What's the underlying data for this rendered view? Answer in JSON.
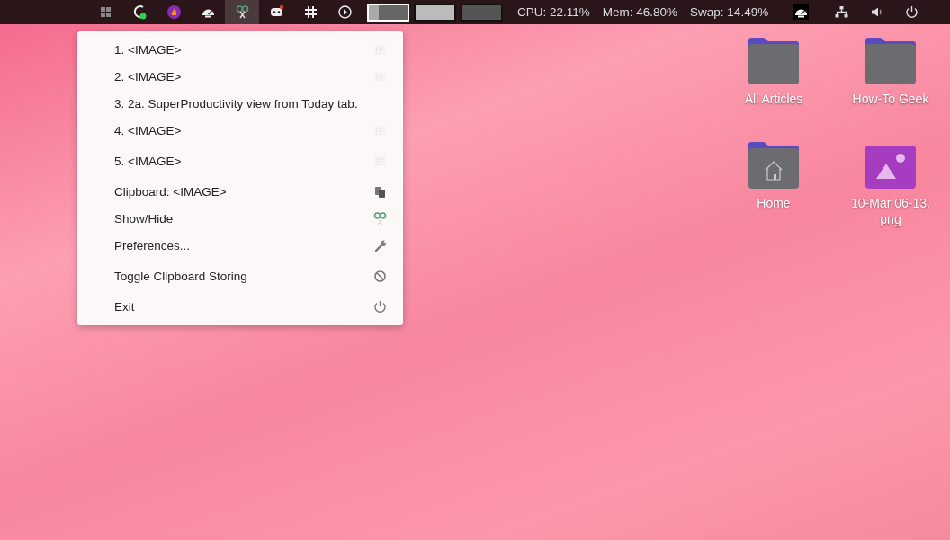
{
  "panel": {
    "apps": [
      {
        "active": false
      },
      {
        "active": false
      },
      {
        "active": false
      },
      {
        "active": false
      },
      {
        "active": true
      },
      {
        "active": false
      },
      {
        "active": false
      },
      {
        "active": false
      }
    ],
    "workspaces": [
      {
        "selected": true
      },
      {
        "selected": false
      },
      {
        "selected": false
      }
    ],
    "stats": [
      "CPU: 22.11%",
      "Mem: 46.80%",
      "Swap: 14.49%"
    ]
  },
  "menu": {
    "items": [
      {
        "label": "1. <IMAGE>"
      },
      {
        "label": "2. <IMAGE>"
      },
      {
        "label": "3. 2a. SuperProductivity view from Today tab."
      },
      {
        "label": "4. <IMAGE>"
      },
      {
        "label": "5. <IMAGE>"
      },
      {
        "label": "Clipboard: <IMAGE>"
      },
      {
        "label": "Show/Hide"
      },
      {
        "label": "Preferences..."
      },
      {
        "label": "Toggle Clipboard Storing"
      },
      {
        "label": "Exit"
      }
    ]
  },
  "desktop": {
    "icons": [
      {
        "label": "All Articles",
        "kind": "folder"
      },
      {
        "label": "How-To Geek",
        "kind": "folder"
      },
      {
        "label": "Home",
        "kind": "home"
      },
      {
        "label": "10-Mar 06-13.\npng",
        "kind": "image"
      }
    ]
  }
}
